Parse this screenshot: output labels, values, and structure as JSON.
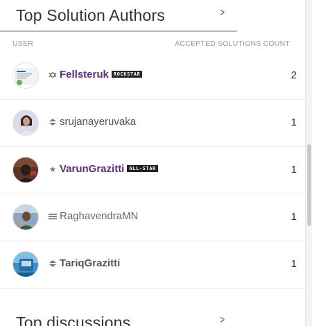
{
  "top_authors": {
    "title": "Top Solution Authors",
    "col_user": "USER",
    "col_count": "ACCEPTED SOLUTIONS COUNT",
    "rows": [
      {
        "name": "Fellsteruk",
        "badge": "ROCKSTAR",
        "count": "2",
        "name_color": "#5a2d82",
        "rank_icon": "rockstar-icon"
      },
      {
        "name": "srujanayeruvaka",
        "badge": "",
        "count": "1",
        "name_color": "#555555",
        "rank_icon": "diamond-chevron-icon"
      },
      {
        "name": "VarunGrazitti",
        "badge": "ALL-STAR",
        "count": "1",
        "name_color": "#5a2d82",
        "rank_icon": "star-icon"
      },
      {
        "name": "RaghavendraMN",
        "badge": "",
        "count": "1",
        "name_color": "#666666",
        "rank_icon": "triple-bar-icon"
      },
      {
        "name": "TariqGrazitti",
        "badge": "",
        "count": "1",
        "name_color": "#555555",
        "rank_icon": "diamond-chevron-icon"
      }
    ]
  },
  "top_discussions": {
    "title": "Top discussions"
  },
  "colors": {
    "accent_purple": "#5a2d82",
    "divider": "#b5b5b5"
  }
}
